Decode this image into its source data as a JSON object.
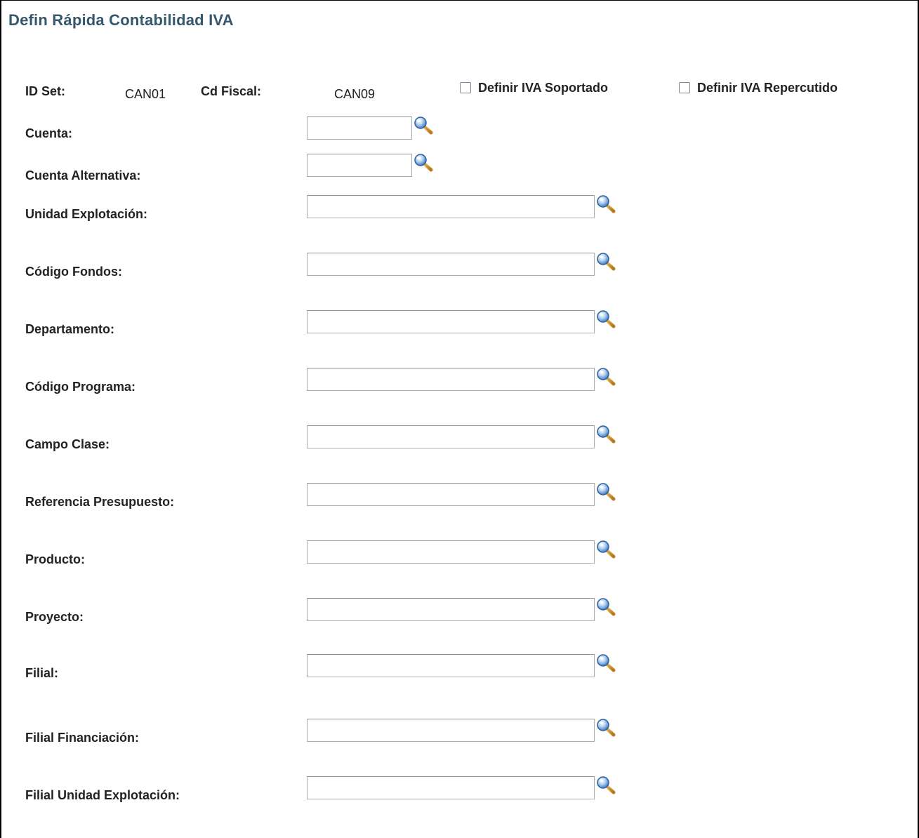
{
  "page_title": "Defin Rápida Contabilidad IVA",
  "header": {
    "setid_label": "ID Set:",
    "setid_value": "CAN01",
    "taxcode_label": "Cd Fiscal:",
    "taxcode_value": "CAN09",
    "checkbox_soportado_label": "Definir IVA Soportado",
    "checkbox_repercutido_label": "Definir IVA Repercutido",
    "checkbox_soportado_checked": false,
    "checkbox_repercutido_checked": false
  },
  "fields": [
    {
      "label": "Cuenta:",
      "value": ""
    },
    {
      "label": "Cuenta Alternativa:",
      "value": ""
    },
    {
      "label": "Unidad Explotación:",
      "value": ""
    },
    {
      "label": "Código Fondos:",
      "value": ""
    },
    {
      "label": "Departamento:",
      "value": ""
    },
    {
      "label": "Código Programa:",
      "value": ""
    },
    {
      "label": "Campo Clase:",
      "value": ""
    },
    {
      "label": "Referencia Presupuesto:",
      "value": ""
    },
    {
      "label": "Producto:",
      "value": ""
    },
    {
      "label": "Proyecto:",
      "value": ""
    },
    {
      "label": "Filial:",
      "value": ""
    },
    {
      "label": "Filial Financiación:",
      "value": ""
    },
    {
      "label": "Filial Unidad Explotación:",
      "value": ""
    }
  ],
  "icons": {
    "lookup": "magnifier-lookup-icon",
    "checkbox": "checkbox-icon"
  },
  "colors": {
    "title": "#35586c",
    "input_border": "#a5acb5"
  }
}
